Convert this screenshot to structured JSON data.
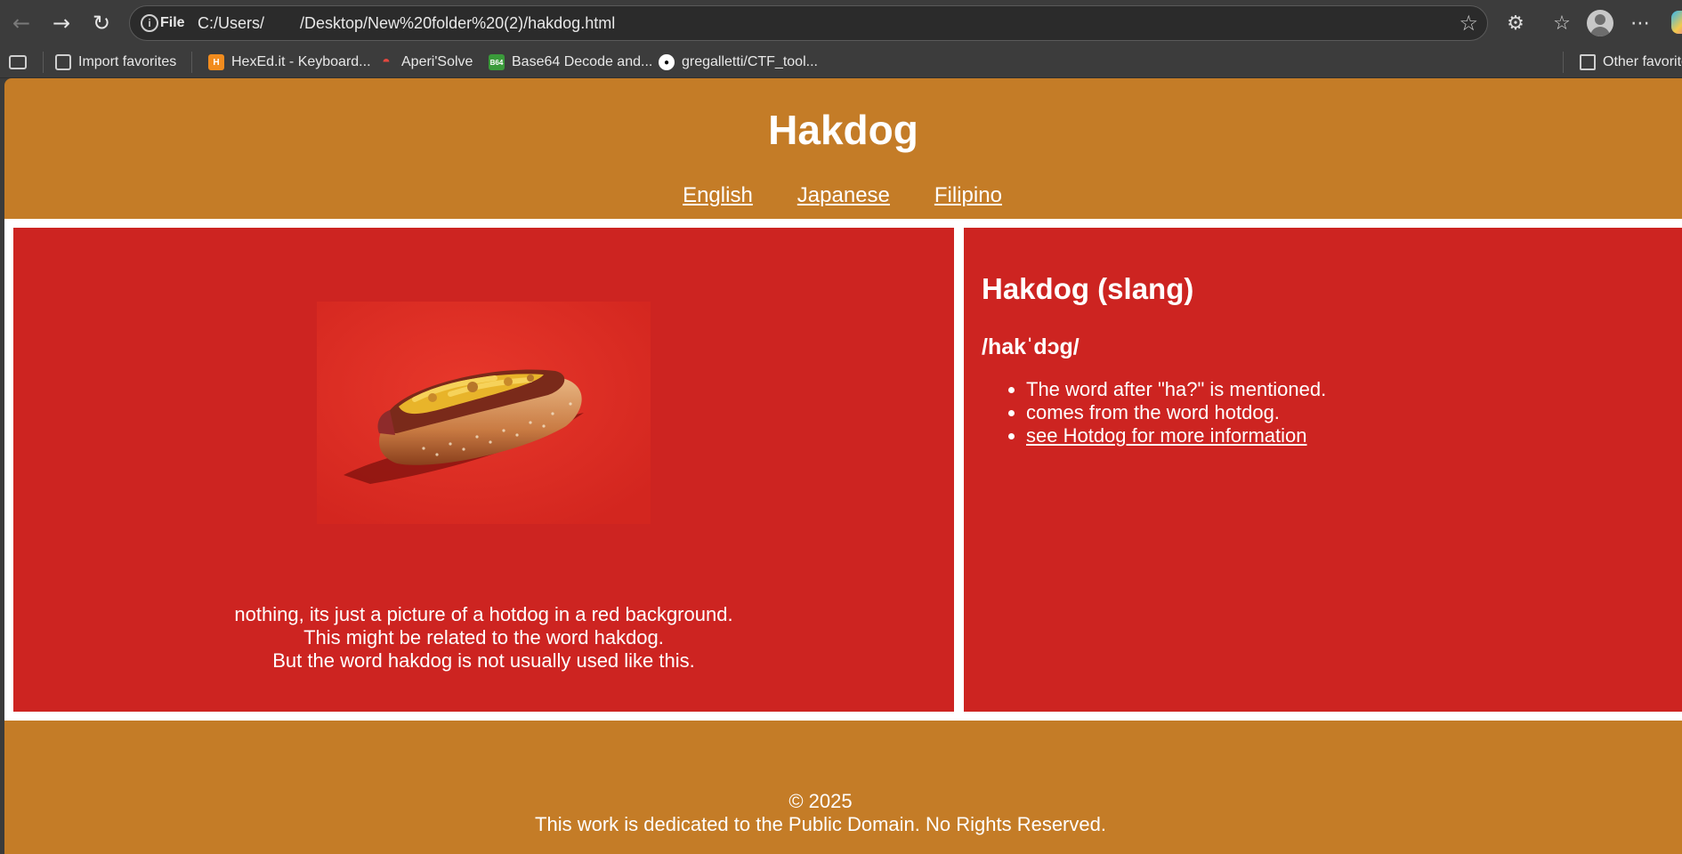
{
  "browser": {
    "url_scheme_label": "File",
    "url": "C:/Users/        /Desktop/New%20folder%20(2)/hakdog.html",
    "bookmarks": [
      {
        "label": "Import favorites"
      },
      {
        "label": "HexEd.it - Keyboard..."
      },
      {
        "label": "Aperi'Solve"
      },
      {
        "label": "Base64 Decode and..."
      },
      {
        "label": "gregalletti/CTF_tool..."
      }
    ],
    "other_favorites": "Other favorites",
    "base64_badge": "B64"
  },
  "page": {
    "title": "Hakdog",
    "nav": [
      {
        "label": "English"
      },
      {
        "label": "Japanese"
      },
      {
        "label": "Filipino"
      }
    ],
    "caption_lines": [
      "nothing, its just a picture of a hotdog in a red background.",
      "This might be related to the word hakdog.",
      "But the word hakdog is not usually used like this."
    ],
    "definition": {
      "title": "Hakdog (slang)",
      "pronunciation": "/hakˈdɔg/",
      "items": [
        "The word after \"ha?\" is mentioned.",
        "comes from the word hotdog."
      ],
      "link_text": "see Hotdog for more information"
    },
    "footer": {
      "copyright": "© 2025",
      "notice": "This work is dedicated to the Public Domain. No Rights Reserved."
    }
  },
  "colors": {
    "page_background": "#c47c27",
    "panel_background": "#cd2421",
    "divider": "#ffffff"
  }
}
